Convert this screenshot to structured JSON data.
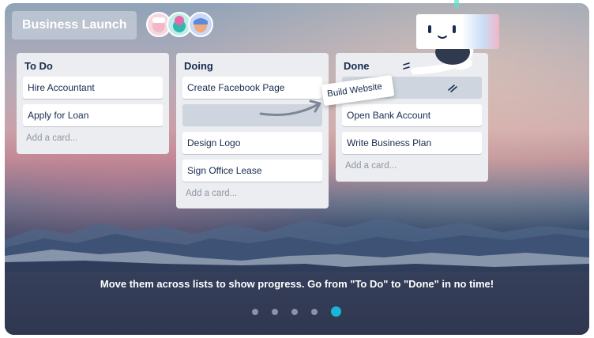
{
  "board": {
    "title": "Business Launch",
    "members": [
      {
        "name": "member-1",
        "color": "#f3b8c8"
      },
      {
        "name": "member-2",
        "color": "#2fb7b0"
      },
      {
        "name": "member-3",
        "color": "#5b8ad8"
      }
    ]
  },
  "lists": [
    {
      "title": "To Do",
      "cards": [
        "Hire Accountant",
        "Apply for Loan"
      ],
      "add_label": "Add a card..."
    },
    {
      "title": "Doing",
      "cards": [
        "Create Facebook Page",
        "Design Logo",
        "Sign Office Lease"
      ],
      "add_label": "Add a card..."
    },
    {
      "title": "Done",
      "cards": [
        "Open Bank Account",
        "Write Business Plan"
      ],
      "add_label": "Add a card..."
    }
  ],
  "dragging_card": "Build Website",
  "caption": "Move them across lists to show progress. Go from \"To Do\" to \"Done\" in no time!",
  "carousel": {
    "total_slides": 5,
    "active_slide": 5
  },
  "colors": {
    "active_dot": "#18b6d9",
    "inactive_dot": "#8a93a8",
    "list_bg": "#ebedf0"
  }
}
